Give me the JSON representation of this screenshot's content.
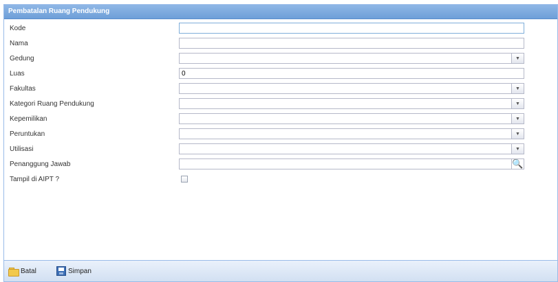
{
  "panel": {
    "title": "Pembatalan Ruang Pendukung"
  },
  "form": {
    "kode": {
      "label": "Kode",
      "value": ""
    },
    "nama": {
      "label": "Nama",
      "value": ""
    },
    "gedung": {
      "label": "Gedung",
      "value": ""
    },
    "luas": {
      "label": "Luas",
      "value": "0"
    },
    "fakultas": {
      "label": "Fakultas",
      "value": ""
    },
    "kategori": {
      "label": "Kategori Ruang Pendukung",
      "value": ""
    },
    "kepemilikan": {
      "label": "Kepemilikan",
      "value": ""
    },
    "peruntukan": {
      "label": "Peruntukan",
      "value": ""
    },
    "utilisasi": {
      "label": "Utilisasi",
      "value": ""
    },
    "penanggung": {
      "label": "Penanggung Jawab",
      "value": ""
    },
    "tampil": {
      "label": "Tampil di AIPT ?",
      "checked": false
    }
  },
  "toolbar": {
    "batal_label": "Batal",
    "simpan_label": "Simpan"
  },
  "icons": {
    "dropdown": "▼",
    "search": "🔍"
  }
}
